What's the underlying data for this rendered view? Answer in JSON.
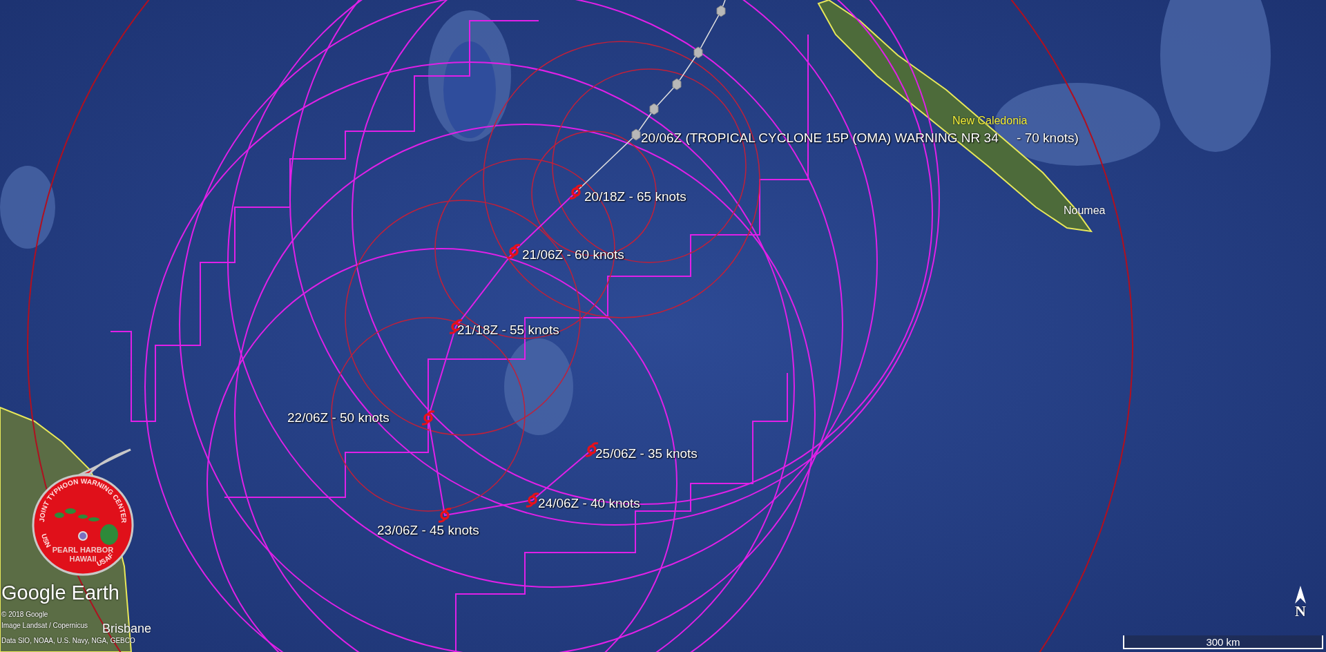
{
  "current_position": {
    "label": "20/06Z (TROPICAL CYCLONE 15P (OMA) WARNING NR 34     - 70 knots)"
  },
  "forecast_points": [
    {
      "label": "20/18Z - 65 knots"
    },
    {
      "label": "21/06Z - 60 knots"
    },
    {
      "label": "21/18Z - 55 knots"
    },
    {
      "label": "22/06Z - 50 knots"
    },
    {
      "label": "23/06Z - 45 knots"
    },
    {
      "label": "24/06Z - 40 knots"
    },
    {
      "label": "25/06Z - 35 knots"
    }
  ],
  "places": [
    {
      "name": "New Caledonia",
      "kind": "region"
    },
    {
      "name": "Noumea",
      "kind": "city"
    },
    {
      "name": "Brisbane",
      "kind": "city"
    }
  ],
  "logo": {
    "ring_text": "JOINT TYPHOON WARNING CENTER",
    "left_text": "USN",
    "right_text": "USAF",
    "line_1": "PEARL HARBOR",
    "line_2": "HAWAII"
  },
  "brand": "Google Earth",
  "attribution": [
    "© 2018 Google",
    "Image Landsat / Copernicus",
    "Data SIO, NOAA, U.S. Navy, NGA, GEBCO"
  ],
  "scale_bar": {
    "label": "300 km"
  },
  "compass": {
    "label": "N"
  }
}
